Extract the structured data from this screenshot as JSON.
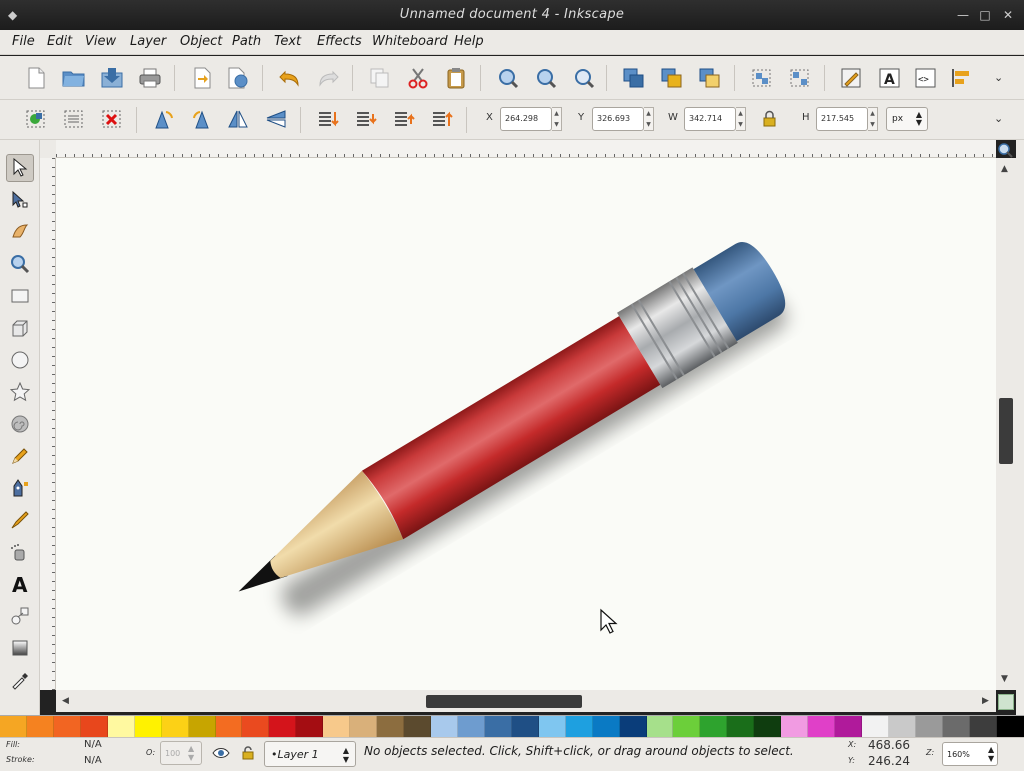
{
  "window": {
    "title": "Unnamed document 4 - Inkscape"
  },
  "menu": [
    "File",
    "Edit",
    "View",
    "Layer",
    "Object",
    "Path",
    "Text",
    "Effects",
    "Whiteboard",
    "Help"
  ],
  "toolbar2": {
    "x_label": "X",
    "x_value": "264.298",
    "y_label": "Y",
    "y_value": "326.693",
    "w_label": "W",
    "w_value": "342.714",
    "h_label": "H",
    "h_value": "217.545",
    "unit": "px"
  },
  "status": {
    "fill_label": "Fill:",
    "fill_value": "N/A",
    "stroke_label": "Stroke:",
    "stroke_value": "N/A",
    "opacity_label": "O:",
    "opacity_value": "100",
    "layer": "•Layer 1",
    "message": "No objects selected. Click, Shift+click, or drag around objects to select.",
    "x_label": "X:",
    "x_value": "468.66",
    "y_label": "Y:",
    "y_value": "246.24",
    "zoom_label": "Z:",
    "zoom_value": "160%"
  },
  "palette_colors": [
    "#f5a623",
    "#f58220",
    "#f26522",
    "#e8471c",
    "#fff9a0",
    "#fff200",
    "#fcd116",
    "#c7a500",
    "#f36c21",
    "#ea4a1f",
    "#d4141b",
    "#a40d12",
    "#f7c98b",
    "#d9b07a",
    "#8c6d3f",
    "#5b4a2e",
    "#a8c9ec",
    "#6e9ccf",
    "#3a6ea5",
    "#1f4f85",
    "#7fc6f0",
    "#1ea0e0",
    "#0a7ac4",
    "#0a3d7a",
    "#a6e08b",
    "#6ccf3a",
    "#2ea32e",
    "#1a6e1a",
    "#0f3d0f",
    "#f19be2",
    "#e040c8",
    "#b01a9b",
    "#f2f2f2",
    "#c9c9c9",
    "#9a9a9a",
    "#6b6b6b",
    "#3d3d3d",
    "#000000"
  ],
  "colors": {
    "pencil_body": "#c42a2a",
    "ferrule": "#b9bcbf",
    "eraser": "#4d77a6",
    "wood": "#e8cf96"
  }
}
